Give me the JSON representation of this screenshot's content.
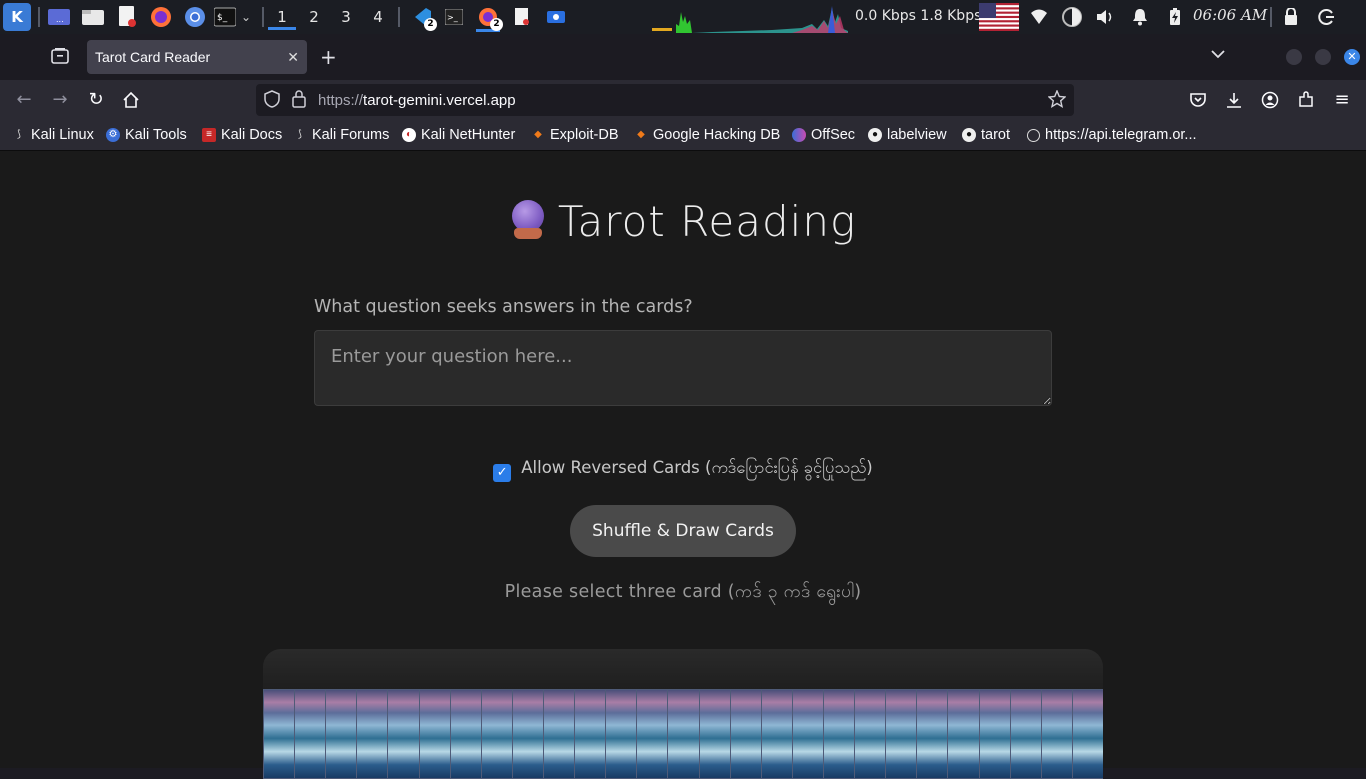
{
  "system_panel": {
    "workspaces": [
      "1",
      "2",
      "3",
      "4"
    ],
    "active_workspace": "1",
    "vscode_badge": "2",
    "firefox_badge": "2",
    "network_speed": "0.0 Kbps 1.8 Kbps",
    "clock": "06:06 AM"
  },
  "browser": {
    "tab_title": "Tarot Card Reader",
    "url_scheme": "https://",
    "url_host": "tarot-gemini.vercel.app",
    "bookmarks": [
      {
        "label": "Kali Linux",
        "icon": "kali-dragon-icon"
      },
      {
        "label": "Kali Tools",
        "icon": "kali-tools-icon"
      },
      {
        "label": "Kali Docs",
        "icon": "kali-docs-icon"
      },
      {
        "label": "Kali Forums",
        "icon": "kali-dragon-icon"
      },
      {
        "label": "Kali NetHunter",
        "icon": "nethunter-icon"
      },
      {
        "label": "Exploit-DB",
        "icon": "exploitdb-icon"
      },
      {
        "label": "Google Hacking DB",
        "icon": "ghdb-icon"
      },
      {
        "label": "OffSec",
        "icon": "offsec-icon"
      },
      {
        "label": "labelview",
        "icon": "github-icon"
      },
      {
        "label": "tarot",
        "icon": "github-icon"
      },
      {
        "label": "https://api.telegram.or...",
        "icon": "globe-icon"
      }
    ]
  },
  "page": {
    "title": "Tarot Reading",
    "question_label": "What question seeks answers in the cards?",
    "question_placeholder": "Enter your question here...",
    "reversed_label": "Allow Reversed Cards (ကဒ်ပြောင်းပြန် ခွင့်ပြုသည်)",
    "reversed_checked": true,
    "shuffle_button": "Shuffle & Draw Cards",
    "select_message": "Please select three card (ကဒ် ၃ ကဒ် ရွေးပါ)",
    "deck_card_count": 27
  },
  "colors": {
    "accent": "#2b7de9",
    "page_bg": "#1a1a1a",
    "button_bg": "#4a4a4a"
  }
}
